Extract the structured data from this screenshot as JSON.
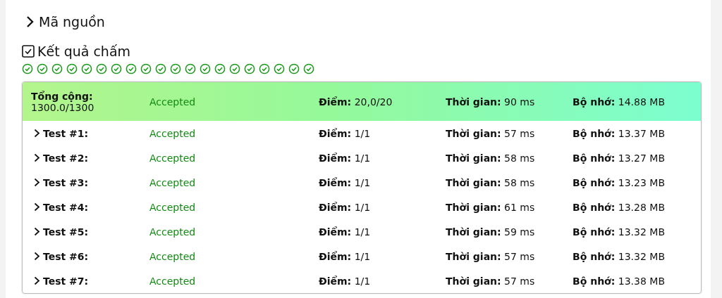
{
  "source_section": {
    "title": "Mã nguồn",
    "expanded": false
  },
  "result_section": {
    "title": "Kết quả chấm"
  },
  "test_icons": [
    {
      "kind": "accepted"
    },
    {
      "kind": "accepted"
    },
    {
      "kind": "accepted"
    },
    {
      "kind": "accepted"
    },
    {
      "kind": "accepted"
    },
    {
      "kind": "accepted"
    },
    {
      "kind": "accepted"
    },
    {
      "kind": "accepted"
    },
    {
      "kind": "accepted"
    },
    {
      "kind": "accepted"
    },
    {
      "kind": "accepted"
    },
    {
      "kind": "accepted"
    },
    {
      "kind": "accepted"
    },
    {
      "kind": "accepted"
    },
    {
      "kind": "accepted"
    },
    {
      "kind": "accepted"
    },
    {
      "kind": "accepted"
    },
    {
      "kind": "accepted"
    },
    {
      "kind": "accepted"
    },
    {
      "kind": "accepted"
    }
  ],
  "summary": {
    "label": "Tổng cộng:",
    "total": "1300.0/1300",
    "status": "Accepted",
    "points": "**Điểm:** 20,0/20",
    "time": "**Thời gian:** 90 ms",
    "memory": "**Bộ nhớ:** 14.88 MB"
  },
  "tests": [
    {
      "label": "Test #1:",
      "expanded": false,
      "status": "Accepted",
      "points": "**Điểm:** 1/1",
      "time": "**Thời gian:** 57 ms",
      "memory": "**Bộ nhớ:** 13.37 MB"
    },
    {
      "label": "Test #2:",
      "expanded": false,
      "status": "Accepted",
      "points": "**Điểm:** 1/1",
      "time": "**Thời gian:** 58 ms",
      "memory": "**Bộ nhớ:** 13.27 MB"
    },
    {
      "label": "Test #3:",
      "expanded": false,
      "status": "Accepted",
      "points": "**Điểm:** 1/1",
      "time": "**Thời gian:** 58 ms",
      "memory": "**Bộ nhớ:** 13.23 MB"
    },
    {
      "label": "Test #4:",
      "expanded": false,
      "status": "Accepted",
      "points": "**Điểm:** 1/1",
      "time": "**Thời gian:** 61 ms",
      "memory": "**Bộ nhớ:** 13.28 MB"
    },
    {
      "label": "Test #5:",
      "expanded": false,
      "status": "Accepted",
      "points": "**Điểm:** 1/1",
      "time": "**Thời gian:** 59 ms",
      "memory": "**Bộ nhớ:** 13.32 MB"
    },
    {
      "label": "Test #6:",
      "expanded": false,
      "status": "Accepted",
      "points": "**Điểm:** 1/1",
      "time": "**Thời gian:** 57 ms",
      "memory": "**Bộ nhớ:** 13.32 MB"
    },
    {
      "label": "Test #7:",
      "expanded": false,
      "status": "Accepted",
      "points": "**Điểm:** 1/1",
      "time": "**Thời gian:** 57 ms",
      "memory": "**Bộ nhớ:** 13.38 MB"
    }
  ]
}
